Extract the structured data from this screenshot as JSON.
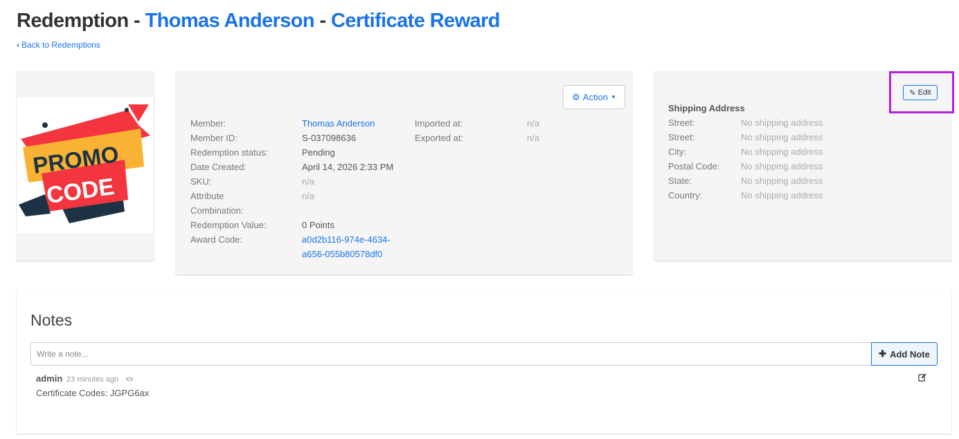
{
  "header": {
    "prefix": "Redemption - ",
    "member_name": "Thomas Anderson",
    "separator": " - ",
    "reward_name": "Certificate Reward",
    "back_link": "Back to Redemptions"
  },
  "promo_image": {
    "line1": "PROMO",
    "line2": "CODE"
  },
  "details": {
    "action_label": "Action",
    "member_label": "Member:",
    "member_value": "Thomas Anderson",
    "member_id_label": "Member ID:",
    "member_id_value": "S-037098636",
    "status_label": "Redemption status:",
    "status_value": "Pending",
    "date_created_label": "Date Created:",
    "date_created_value": "April 14, 2026 2:33 PM",
    "sku_label": "SKU:",
    "sku_value": "n/a",
    "attribute_label_1": "Attribute",
    "attribute_label_2": "Combination:",
    "attribute_value": "n/a",
    "redemption_value_label": "Redemption Value:",
    "redemption_value": "0 Points",
    "award_code_label": "Award Code:",
    "award_code_line1": "a0d2b116-974e-4634-",
    "award_code_line2": "a656-055b80578df0",
    "imported_label": "Imported at:",
    "imported_value": "n/a",
    "exported_label": "Exported at:",
    "exported_value": "n/a"
  },
  "shipping": {
    "edit_label": "Edit",
    "heading": "Shipping Address",
    "rows": [
      {
        "label": "Street:",
        "value": "No shipping address"
      },
      {
        "label": "Street:",
        "value": "No shipping address"
      },
      {
        "label": "City:",
        "value": "No shipping address"
      },
      {
        "label": "Postal Code:",
        "value": "No shipping address"
      },
      {
        "label": "State:",
        "value": "No shipping address"
      },
      {
        "label": "Country:",
        "value": "No shipping address"
      }
    ]
  },
  "notes": {
    "title": "Notes",
    "placeholder": "Write a note...",
    "add_label": "Add Note",
    "items": [
      {
        "author": "admin",
        "time": "23 minutes ago",
        "text": "Certificate Codes: JGPG6ax"
      }
    ]
  },
  "colors": {
    "link": "#1a73e8",
    "highlight": "#b620e0",
    "panel": "#f5f5f5",
    "promo_red": "#f2353e",
    "promo_yellow": "#f9b234",
    "promo_navy": "#1d3345"
  }
}
